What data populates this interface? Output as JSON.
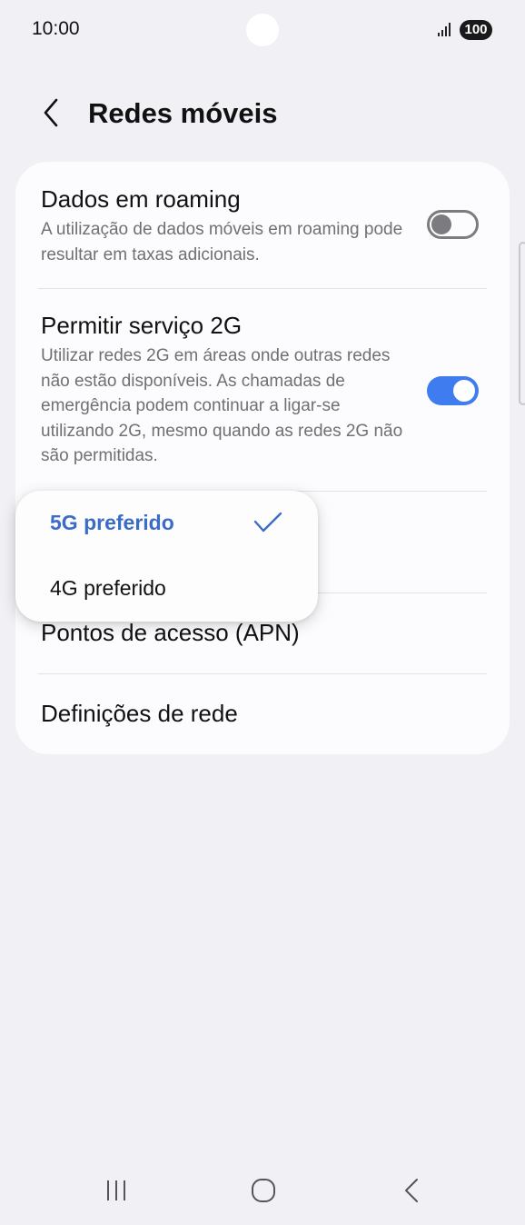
{
  "status_bar": {
    "time": "10:00",
    "battery": "100",
    "icons": [
      "signal-icon",
      "battery-icon"
    ]
  },
  "header": {
    "title": "Redes móveis",
    "back_icon": "chevron-left-icon"
  },
  "settings": [
    {
      "title": "Dados em roaming",
      "description": "A utilização de dados móveis em roaming pode resultar em taxas adicionais.",
      "toggle": "off"
    },
    {
      "title": "Permitir serviço 2G",
      "description": "Utilizar redes 2G em áreas onde outras redes não estão disponíveis. As chamadas de emergência podem continuar a ligar-se utilizando 2G, mesmo quando as redes 2G não são permitidas.",
      "toggle": "on"
    },
    {
      "title": "Pontos de acesso (APN)"
    },
    {
      "title": "Definições de rede"
    }
  ],
  "network_mode_menu": {
    "options": [
      {
        "label": "5G preferido",
        "selected": true
      },
      {
        "label": "4G preferido",
        "selected": false
      }
    ],
    "check_icon": "check-icon"
  },
  "nav_bar": {
    "icons": [
      "recent-apps-icon",
      "home-icon",
      "back-icon"
    ]
  },
  "colors": {
    "background": "#f1f0f5",
    "card": "#fcfcfe",
    "accent": "#3e7cf0",
    "selected_text": "#3a6cc8",
    "secondary_text": "#707070"
  }
}
